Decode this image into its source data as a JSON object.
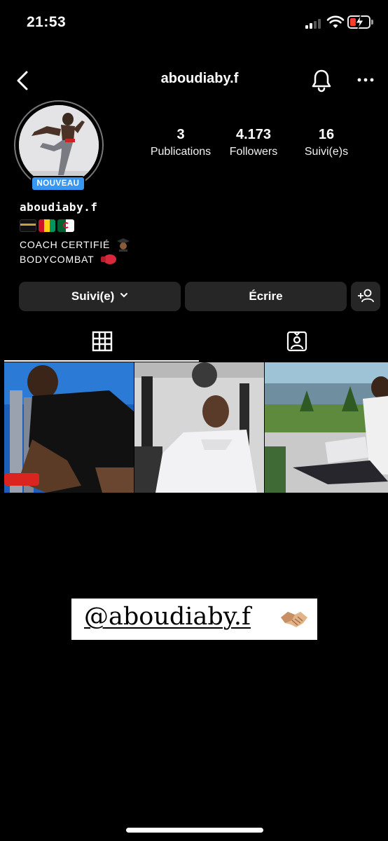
{
  "status_bar": {
    "time": "21:53",
    "icons": [
      "signal-icon",
      "wifi-icon",
      "battery-low-charging-icon"
    ]
  },
  "header": {
    "username": "aboudiaby.f",
    "icons": [
      "back-chevron-icon",
      "notification-bell-icon",
      "more-options-icon"
    ]
  },
  "profile": {
    "badge": "NOUVEAU",
    "stats": [
      {
        "value": "3",
        "label": "Publications"
      },
      {
        "value": "4.173",
        "label": "Followers"
      },
      {
        "value": "16",
        "label": "Suivi(e)s"
      }
    ],
    "bio": {
      "name": "aboudiaby.f",
      "flags": [
        "kaaba-emoji",
        "guinea-flag",
        "algeria-flag"
      ],
      "line1": "COACH CERTIFIÉ",
      "line1_emoji": "graduate-emoji",
      "line2": "BODYCOMBAT",
      "line2_emoji": "boxing-glove-emoji"
    }
  },
  "actions": {
    "follow_label": "Suivi(e)",
    "message_label": "Écrire",
    "add_icon": "add-person-icon"
  },
  "tabs": [
    {
      "icon": "grid-icon",
      "active": true
    },
    {
      "icon": "tagged-person-icon",
      "active": false
    }
  ],
  "posts": [
    {
      "icon": "post-photo-boxer"
    },
    {
      "icon": "post-photo-gym"
    },
    {
      "icon": "post-photo-laptop"
    }
  ],
  "story_tag": {
    "text": "@aboudiaby.f",
    "emoji": "handshake-emoji"
  },
  "colors": {
    "background": "#000000",
    "button": "#262626",
    "badge": "#3897f0",
    "battery_low": "#ff3b30"
  }
}
